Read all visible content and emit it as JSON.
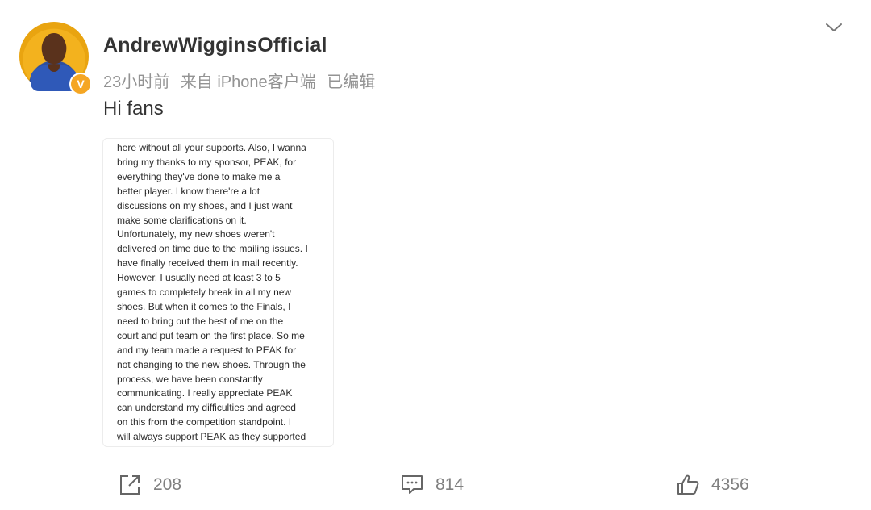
{
  "user": {
    "name": "AndrewWigginsOfficial",
    "verified_badge": "V",
    "verified_color": "#f5a623"
  },
  "meta": {
    "time": "23小时前",
    "source": "来自 iPhone客户端",
    "edited": "已编辑"
  },
  "post": {
    "text": "Hi fans",
    "image_lines": [
      "here without all your supports. Also, I wanna",
      "bring my thanks to my sponsor, PEAK, for",
      "everything they've done to make me a",
      "better player. I know there're a lot",
      "discussions on my shoes, and I just want",
      "make some clarifications on it.",
      "Unfortunately, my new shoes weren't",
      "delivered on time due to the mailing issues. I",
      "have finally received them in mail recently.",
      "However, I usually need at least 3 to 5",
      "games to completely break in all my new",
      "shoes. But when it comes to the Finals, I",
      "need to bring out the best of me on the",
      "court and put team on the first place. So me",
      "and my team made a request to PEAK for",
      "not changing to the new shoes. Through the",
      "process, we have been constantly",
      "communicating. I really appreciate PEAK",
      "can understand my difficulties and agreed",
      "on this from the competition standpoint. I",
      "will always support PEAK as they supported"
    ]
  },
  "actions": {
    "repost": {
      "icon": "share-icon",
      "count": "208"
    },
    "comment": {
      "icon": "comment-icon",
      "count": "814"
    },
    "like": {
      "icon": "thumbs-up-icon",
      "count": "4356"
    }
  },
  "menu": {
    "icon": "chevron-down-icon"
  }
}
